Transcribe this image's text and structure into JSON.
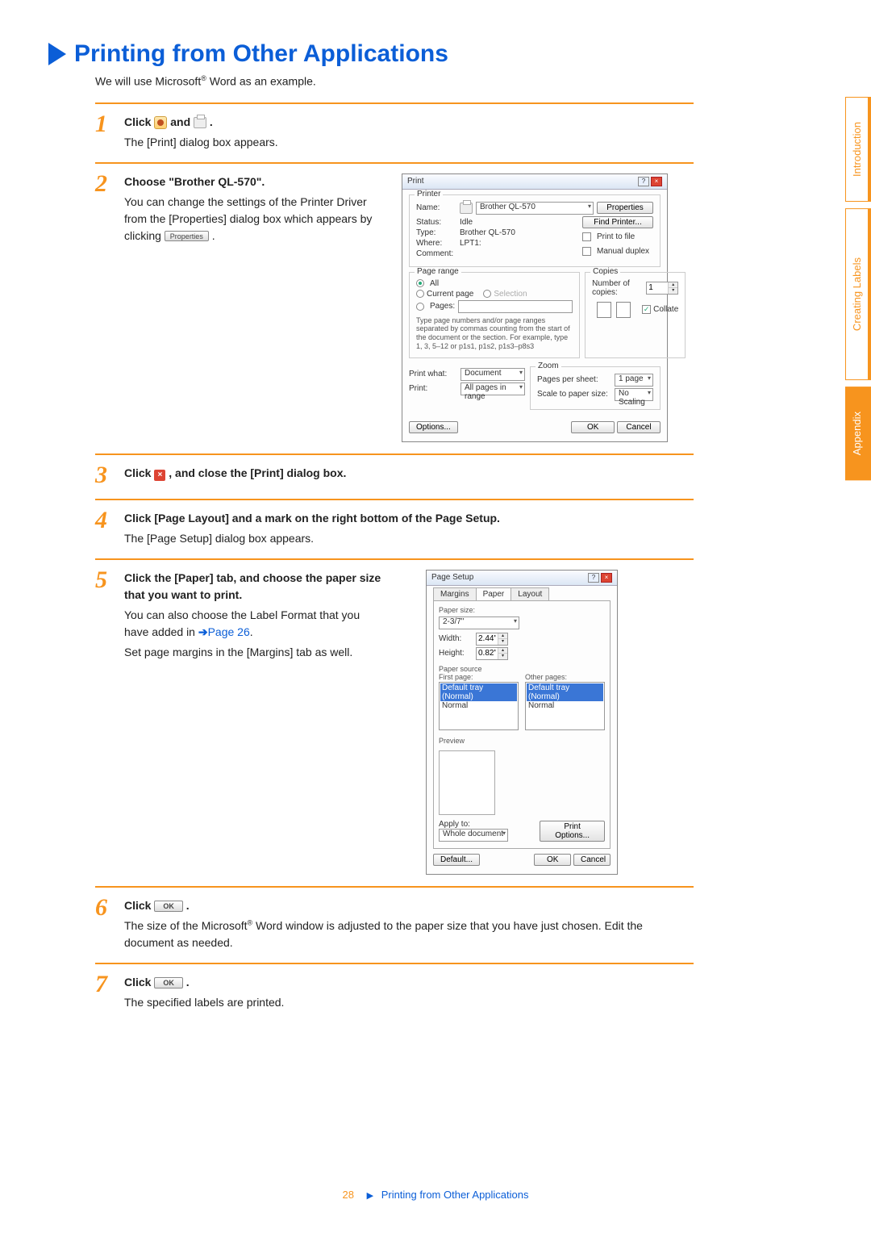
{
  "title": "Printing from Other Applications",
  "intro_pre": "We will use Microsoft",
  "intro_sup": "®",
  "intro_post": " Word as an example.",
  "side_tabs": {
    "intro": "Introduction",
    "creating": "Creating Labels",
    "appendix": "Appendix"
  },
  "steps": {
    "s1": {
      "num": "1",
      "head_a": "Click ",
      "head_b": " and ",
      "head_c": ".",
      "text": "The [Print] dialog box appears."
    },
    "s2": {
      "num": "2",
      "head": "Choose \"Brother QL-570\".",
      "text_a": "You can change the settings of the Printer Driver from the [Properties] dialog box which appears by clicking ",
      "btn": "Properties",
      "text_b": "."
    },
    "s3": {
      "num": "3",
      "head_a": "Click ",
      "head_b": ", and close the [Print] dialog box."
    },
    "s4": {
      "num": "4",
      "head": "Click [Page Layout] and a mark on the right bottom of the Page Setup.",
      "text": "The [Page Setup] dialog box appears."
    },
    "s5": {
      "num": "5",
      "head": "Click the [Paper] tab, and choose the paper size that you want to print.",
      "text_a": "You can also choose the Label Format that you have added in ",
      "link": "Page 26",
      "text_b": ".",
      "text_c": "Set page margins in the [Margins] tab as well."
    },
    "s6": {
      "num": "6",
      "head_a": "Click ",
      "btn": "OK",
      "head_b": ".",
      "text_a": "The size of the Microsoft",
      "text_sup": "®",
      "text_b": " Word window is adjusted to the paper size that you have just chosen. Edit the document as needed."
    },
    "s7": {
      "num": "7",
      "head_a": "Click ",
      "btn": "OK",
      "head_b": ".",
      "text": "The specified labels are printed."
    }
  },
  "print_dialog": {
    "title": "Print",
    "printer_legend": "Printer",
    "name_lbl": "Name:",
    "name_val": "Brother QL-570",
    "status_lbl": "Status:",
    "status_val": "Idle",
    "type_lbl": "Type:",
    "type_val": "Brother QL-570",
    "where_lbl": "Where:",
    "where_val": "LPT1:",
    "comment_lbl": "Comment:",
    "properties_btn": "Properties",
    "find_btn": "Find Printer...",
    "print_file": "Print to file",
    "manual_duplex": "Manual duplex",
    "range_legend": "Page range",
    "all": "All",
    "current": "Current page",
    "selection": "Selection",
    "pages": "Pages:",
    "range_note": "Type page numbers and/or page ranges separated by commas counting from the start of the document or the section. For example, type 1, 3, 5–12 or p1s1, p1s2, p1s3–p8s3",
    "copies_legend": "Copies",
    "num_copies_lbl": "Number of copies:",
    "num_copies_val": "1",
    "collate": "Collate",
    "print_what_lbl": "Print what:",
    "print_what_val": "Document",
    "print_lbl": "Print:",
    "print_val": "All pages in range",
    "zoom_legend": "Zoom",
    "pps_lbl": "Pages per sheet:",
    "pps_val": "1 page",
    "scale_lbl": "Scale to paper size:",
    "scale_val": "No Scaling",
    "options_btn": "Options...",
    "ok_btn": "OK",
    "cancel_btn": "Cancel"
  },
  "page_setup_dialog": {
    "title": "Page Setup",
    "tab_margins": "Margins",
    "tab_paper": "Paper",
    "tab_layout": "Layout",
    "paper_size_lbl": "Paper size:",
    "paper_size_val": "2-3/7\"",
    "width_lbl": "Width:",
    "width_val": "2.44\"",
    "height_lbl": "Height:",
    "height_val": "0.82\"",
    "paper_source_lbl": "Paper source",
    "first_page_lbl": "First page:",
    "other_pages_lbl": "Other pages:",
    "tray_default": "Default tray (Normal)",
    "tray_normal": "Normal",
    "preview_lbl": "Preview",
    "apply_to_lbl": "Apply to:",
    "apply_to_val": "Whole document",
    "print_options_btn": "Print Options...",
    "default_btn": "Default...",
    "ok_btn": "OK",
    "cancel_btn": "Cancel"
  },
  "footer": {
    "page_num": "28",
    "title": "Printing from Other Applications"
  }
}
